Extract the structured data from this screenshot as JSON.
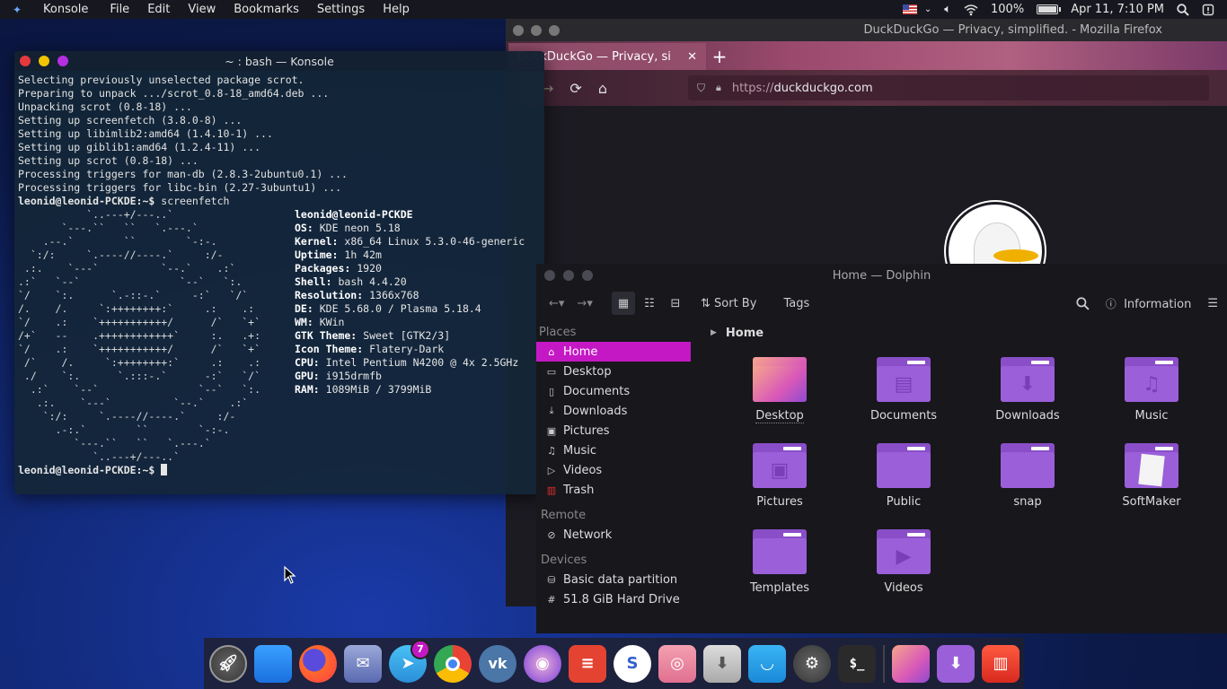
{
  "topbar": {
    "app_name": "Konsole",
    "menu": [
      "File",
      "Edit",
      "View",
      "Bookmarks",
      "Settings",
      "Help"
    ],
    "battery": "100%",
    "datetime": "Apr 11, 7:10 PM"
  },
  "konsole": {
    "title": "~ : bash — Konsole",
    "output_lines": [
      "Selecting previously unselected package scrot.",
      "Preparing to unpack .../scrot_0.8-18_amd64.deb ...",
      "Unpacking scrot (0.8-18) ...",
      "Setting up screenfetch (3.8.0-8) ...",
      "Setting up libimlib2:amd64 (1.4.10-1) ...",
      "Setting up giblib1:amd64 (1.2.4-11) ...",
      "Setting up scrot (0.8-18) ...",
      "Processing triggers for man-db (2.8.3-2ubuntu0.1) ...",
      "Processing triggers for libc-bin (2.27-3ubuntu1) ..."
    ],
    "prompt": "leonid@leonid-PCKDE:~$",
    "command": "screenfetch",
    "screenfetch": {
      "user_host": "leonid@leonid-PCKDE",
      "info": [
        {
          "key": "OS:",
          "value": "KDE neon 5.18"
        },
        {
          "key": "Kernel:",
          "value": "x86_64 Linux 5.3.0-46-generic"
        },
        {
          "key": "Uptime:",
          "value": "1h 42m"
        },
        {
          "key": "Packages:",
          "value": "1920"
        },
        {
          "key": "Shell:",
          "value": "bash 4.4.20"
        },
        {
          "key": "Resolution:",
          "value": "1366x768"
        },
        {
          "key": "DE:",
          "value": "KDE 5.68.0 / Plasma 5.18.4"
        },
        {
          "key": "WM:",
          "value": "KWin"
        },
        {
          "key": "GTK Theme:",
          "value": "Sweet [GTK2/3]"
        },
        {
          "key": "Icon Theme:",
          "value": "Flatery-Dark"
        },
        {
          "key": "CPU:",
          "value": "Intel Pentium N4200 @ 4x 2.5GHz"
        },
        {
          "key": "GPU:",
          "value": "i915drmfb"
        },
        {
          "key": "RAM:",
          "value": "1089MiB / 3799MiB"
        }
      ]
    }
  },
  "firefox": {
    "window_title": "DuckDuckGo — Privacy, simplified. - Mozilla Firefox",
    "tab_title": "DuckDuckGo — Privacy, si",
    "url_prefix": "https://",
    "url_host": "duckduckgo.com"
  },
  "dolphin": {
    "title": "Home — Dolphin",
    "sort_label": "Sort By",
    "tags_label": "Tags",
    "info_label": "Information",
    "sections": {
      "places": "Places",
      "remote": "Remote",
      "devices": "Devices"
    },
    "places": [
      "Home",
      "Desktop",
      "Documents",
      "Downloads",
      "Pictures",
      "Music",
      "Videos",
      "Trash"
    ],
    "remote": [
      "Network"
    ],
    "devices": [
      "Basic data partition",
      "51.8 GiB Hard Drive"
    ],
    "breadcrumb": "Home",
    "items": [
      "Desktop",
      "Documents",
      "Downloads",
      "Music",
      "Pictures",
      "Public",
      "snap",
      "SoftMaker",
      "Templates",
      "Videos"
    ]
  },
  "dock": {
    "telegram_badge": "7"
  }
}
